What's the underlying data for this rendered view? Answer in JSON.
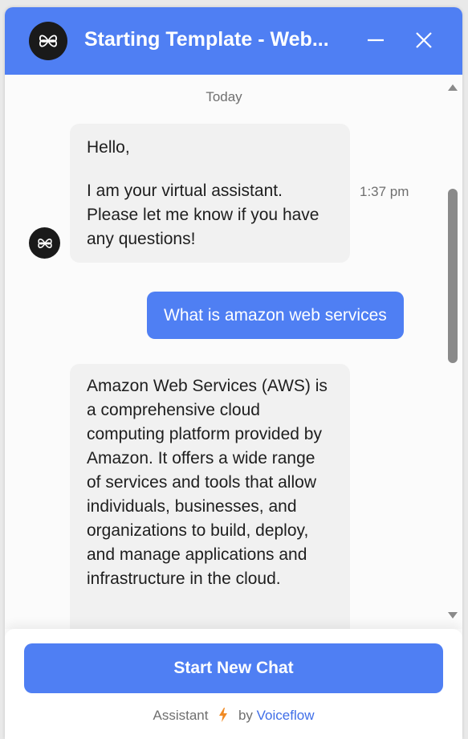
{
  "header": {
    "title": "Starting Template - Web...",
    "logo_icon": "voiceflow-logo-icon",
    "minimize_icon": "minimize-icon",
    "close_icon": "close-icon",
    "color": "#4f7ff3"
  },
  "messages": {
    "day_label": "Today",
    "assistant_1": {
      "greeting": "Hello,",
      "text": "I am your virtual assistant. Please let me know if you have any questions!",
      "time": "1:37 pm"
    },
    "user_1": {
      "text": "What is amazon web services"
    },
    "assistant_2": {
      "text": "Amazon Web Services (AWS) is a comprehensive cloud computing platform provided by Amazon. It offers a wide range of services and tools that allow individuals, businesses, and organizations to build, deploy, and manage applications and infrastructure in the cloud."
    }
  },
  "footer": {
    "start_button_label": "Start New Chat",
    "powered_prefix": "Assistant",
    "powered_by": "by",
    "brand": "Voiceflow",
    "bolt_icon": "lightning-bolt-icon",
    "bolt_color": "#f08a24"
  }
}
